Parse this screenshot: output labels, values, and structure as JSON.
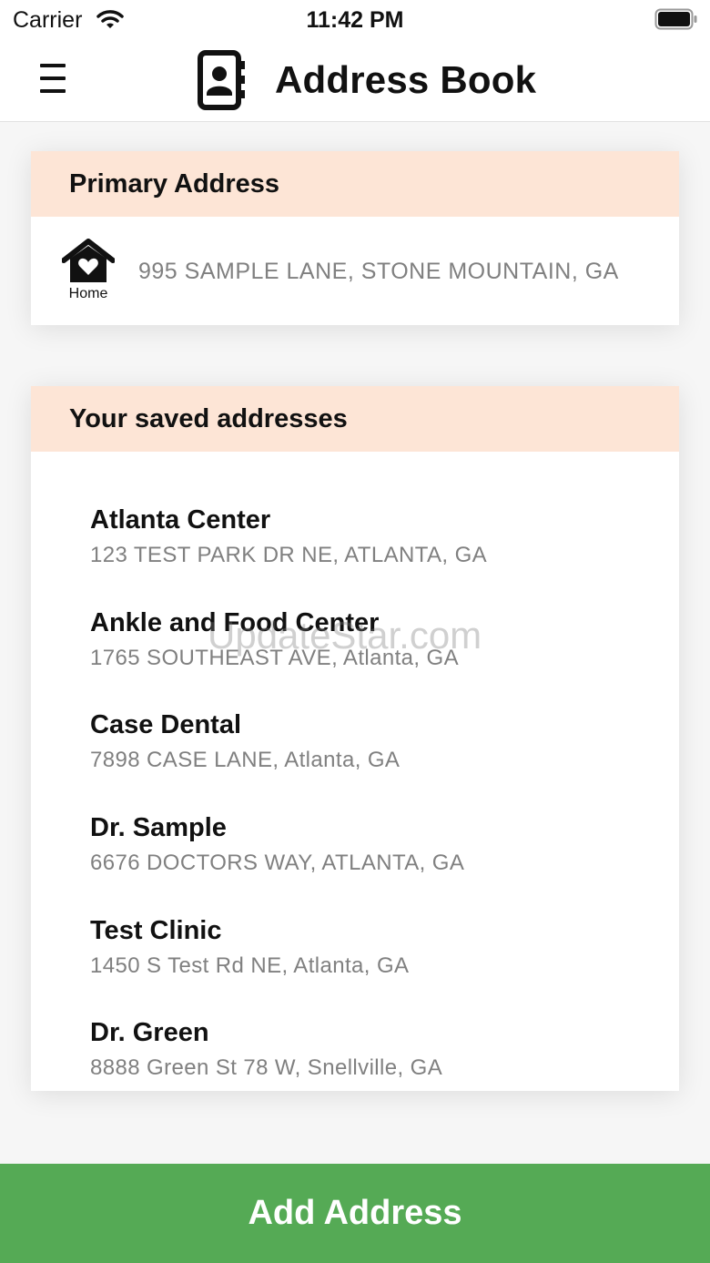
{
  "status_bar": {
    "carrier": "Carrier",
    "time": "11:42 PM",
    "icons": [
      "wifi-icon",
      "battery-icon"
    ]
  },
  "header": {
    "title": "Address Book",
    "menu_icon": "hamburger-menu-icon",
    "title_icon": "address-book-icon"
  },
  "primary": {
    "heading": "Primary Address",
    "icon": "home-heart-icon",
    "icon_label": "Home",
    "address": "995 SAMPLE LANE, STONE MOUNTAIN, GA"
  },
  "saved": {
    "heading": "Your saved addresses",
    "items": [
      {
        "name": "Atlanta Center",
        "address": "123 TEST PARK DR NE, ATLANTA, GA"
      },
      {
        "name": "Ankle and Food Center",
        "address": "1765 SOUTHEAST AVE, Atlanta, GA"
      },
      {
        "name": "Case Dental",
        "address": "7898 CASE LANE, Atlanta, GA"
      },
      {
        "name": "Dr. Sample",
        "address": "6676 DOCTORS WAY, ATLANTA, GA"
      },
      {
        "name": "Test Clinic",
        "address": "1450 S Test Rd NE, Atlanta, GA"
      },
      {
        "name": "Dr. Green",
        "address": "8888 Green St 78 W, Snellville, GA"
      }
    ]
  },
  "watermark": "UpdateStar.com",
  "add_button": {
    "label": "Add Address"
  },
  "colors": {
    "header_peach": "#fde5d6",
    "button_green": "#55aa55",
    "muted_text": "#808080",
    "background": "#f6f6f6"
  }
}
